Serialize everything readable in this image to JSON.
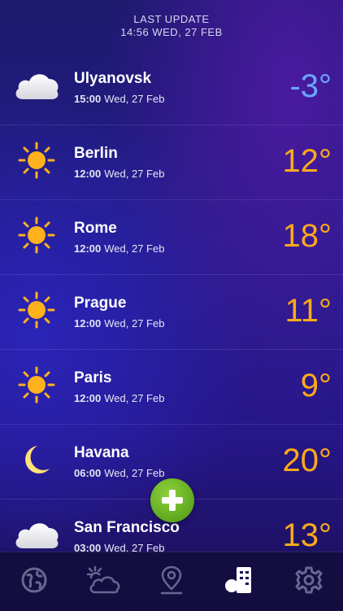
{
  "header": {
    "line1": "LAST UPDATE",
    "line2": "14:56 WED, 27 FEB"
  },
  "cities": [
    {
      "name": "Ulyanovsk",
      "time": "15:00",
      "date": "Wed, 27 Feb",
      "temp": "-3°",
      "icon": "cloud-icon",
      "cold": true
    },
    {
      "name": "Berlin",
      "time": "12:00",
      "date": "Wed, 27 Feb",
      "temp": "12°",
      "icon": "sun-icon",
      "cold": false
    },
    {
      "name": "Rome",
      "time": "12:00",
      "date": "Wed, 27 Feb",
      "temp": "18°",
      "icon": "sun-icon",
      "cold": false
    },
    {
      "name": "Prague",
      "time": "12:00",
      "date": "Wed, 27 Feb",
      "temp": "11°",
      "icon": "sun-icon",
      "cold": false
    },
    {
      "name": "Paris",
      "time": "12:00",
      "date": "Wed, 27 Feb",
      "temp": "9°",
      "icon": "sun-icon",
      "cold": false
    },
    {
      "name": "Havana",
      "time": "06:00",
      "date": "Wed, 27 Feb",
      "temp": "20°",
      "icon": "moon-icon",
      "cold": false
    },
    {
      "name": "San Francisco",
      "time": "03:00",
      "date": "Wed, 27 Feb",
      "temp": "13°",
      "icon": "cloud-icon",
      "cold": false
    }
  ],
  "tabs": [
    {
      "icon": "globe-icon",
      "active": false
    },
    {
      "icon": "sun-cloud-icon",
      "active": false
    },
    {
      "icon": "location-pin-icon",
      "active": false
    },
    {
      "icon": "city-list-icon",
      "active": true
    },
    {
      "icon": "gear-icon",
      "active": false
    }
  ],
  "colors": {
    "warm": "#ffaa1a",
    "cold": "#6aa6ff",
    "accent_green": "#6cb824"
  }
}
